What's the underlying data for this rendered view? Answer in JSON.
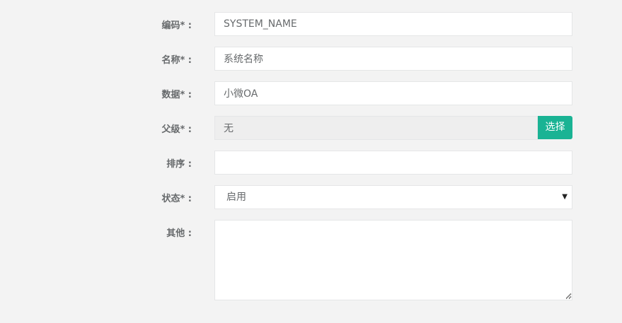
{
  "form": {
    "code": {
      "label": "编码* :",
      "value": "SYSTEM_NAME"
    },
    "name": {
      "label": "名称* :",
      "value": "系统名称"
    },
    "data": {
      "label": "数据* :",
      "value": "小微OA"
    },
    "parent": {
      "label": "父级* :",
      "value": "无",
      "button_label": "选择"
    },
    "sort": {
      "label": "排序 :",
      "value": ""
    },
    "status": {
      "label": "状态* :",
      "selected": "启用",
      "caret": "▼"
    },
    "other": {
      "label": "其他 :",
      "value": ""
    }
  },
  "colors": {
    "accent": "#1ab394",
    "background": "#f3f3f3",
    "field_border": "#e5e6e7",
    "readonly_bg": "#eeeeee",
    "text": "#676a6c"
  },
  "icons": {
    "status_dropdown": "caret-down-icon",
    "textarea_resize": "resize-grip-icon"
  }
}
